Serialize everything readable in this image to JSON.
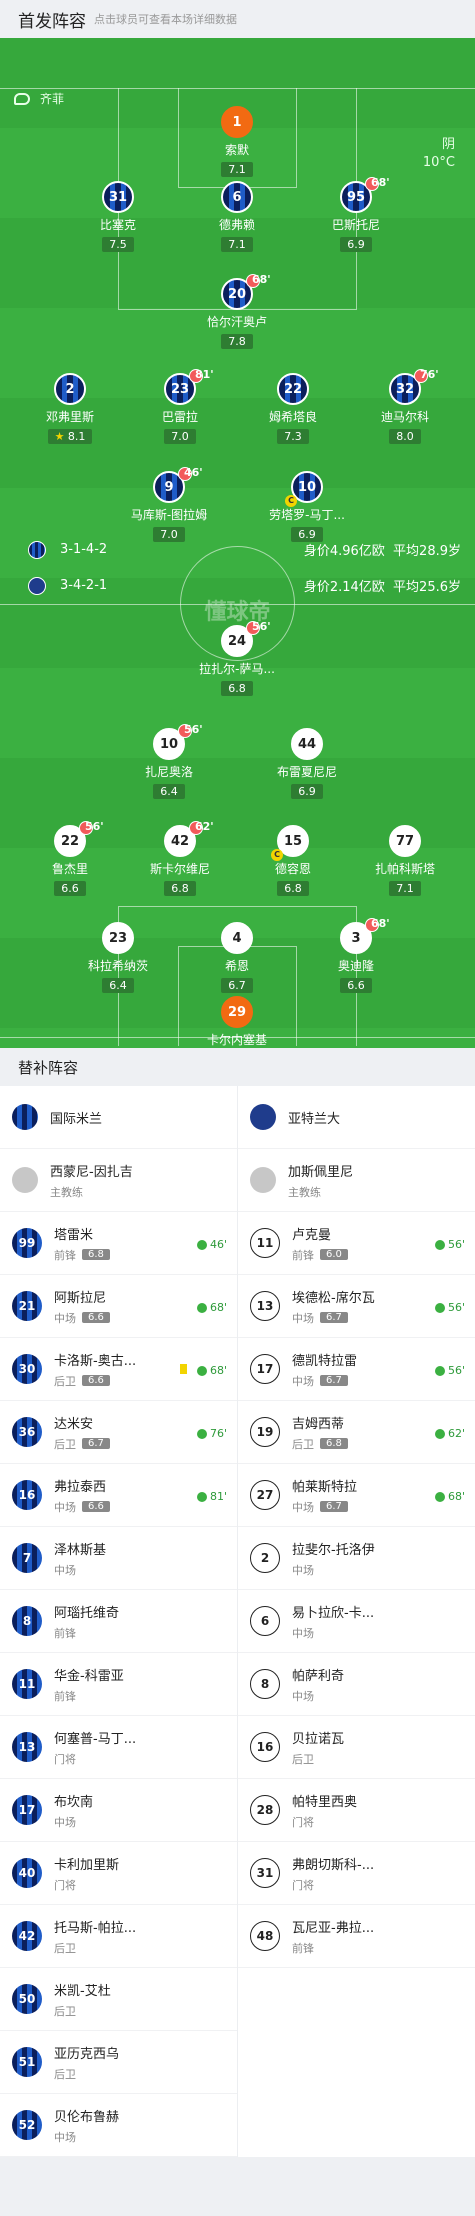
{
  "header": {
    "title": "首发阵容",
    "subtitle": "点击球员可查看本场详细数据"
  },
  "pitch": {
    "referee": "齐菲",
    "weather": {
      "cond": "阴",
      "temp": "10°C"
    },
    "home_formation": "3-1-4-2",
    "home_value": "身价4.96亿欧",
    "home_age": "平均28.9岁",
    "away_formation": "3-4-2-1",
    "away_value": "身价2.14亿欧",
    "away_age": "平均25.6岁",
    "watermark": "懂球帝"
  },
  "home_players": [
    {
      "num": "1",
      "name": "索默",
      "rating": "7.1",
      "gk": true
    },
    {
      "num": "31",
      "name": "比塞克",
      "rating": "7.5"
    },
    {
      "num": "6",
      "name": "德弗赖",
      "rating": "7.1"
    },
    {
      "num": "95",
      "name": "巴斯托尼",
      "rating": "6.9",
      "sub": "68'"
    },
    {
      "num": "20",
      "name": "恰尔汗奥卢",
      "rating": "7.8",
      "sub": "68'"
    },
    {
      "num": "2",
      "name": "邓弗里斯",
      "rating": "8.1",
      "star": true
    },
    {
      "num": "23",
      "name": "巴雷拉",
      "rating": "7.0",
      "sub": "81'"
    },
    {
      "num": "22",
      "name": "姆希塔良",
      "rating": "7.3"
    },
    {
      "num": "32",
      "name": "迪马尔科",
      "rating": "8.0",
      "sub": "76'"
    },
    {
      "num": "9",
      "name": "马库斯-图拉姆",
      "rating": "7.0",
      "sub": "46'"
    },
    {
      "num": "10",
      "name": "劳塔罗-马丁...",
      "rating": "6.9",
      "captain": true
    }
  ],
  "away_players": [
    {
      "num": "24",
      "name": "拉扎尔-萨马...",
      "rating": "6.8",
      "sub": "56'"
    },
    {
      "num": "10",
      "name": "扎尼奥洛",
      "rating": "6.4",
      "sub": "56'"
    },
    {
      "num": "44",
      "name": "布雷夏尼尼",
      "rating": "6.9"
    },
    {
      "num": "22",
      "name": "鲁杰里",
      "rating": "6.6",
      "sub": "56'"
    },
    {
      "num": "42",
      "name": "斯卡尔维尼",
      "rating": "6.8",
      "sub": "62'",
      "yellow": true
    },
    {
      "num": "15",
      "name": "德容恩",
      "rating": "6.8",
      "captain": true
    },
    {
      "num": "77",
      "name": "扎帕科斯塔",
      "rating": "7.1"
    },
    {
      "num": "23",
      "name": "科拉希纳茨",
      "rating": "6.4"
    },
    {
      "num": "4",
      "name": "希恩",
      "rating": "6.7"
    },
    {
      "num": "3",
      "name": "奥迪隆",
      "rating": "6.6",
      "sub": "68'"
    },
    {
      "num": "29",
      "name": "卡尔内塞基",
      "rating": "7.0",
      "gk": true
    }
  ],
  "subs_title": "替补阵容",
  "home_team": "国际米兰",
  "away_team": "亚特兰大",
  "home_coach": {
    "name": "西蒙尼-因扎吉",
    "role": "主教练"
  },
  "away_coach": {
    "name": "加斯佩里尼",
    "role": "主教练"
  },
  "home_subs": [
    {
      "num": "99",
      "name": "塔雷米",
      "pos": "前锋",
      "rating": "6.8",
      "in": "46'"
    },
    {
      "num": "21",
      "name": "阿斯拉尼",
      "pos": "中场",
      "rating": "6.6",
      "in": "68'"
    },
    {
      "num": "30",
      "name": "卡洛斯-奥古...",
      "pos": "后卫",
      "rating": "6.6",
      "in": "68'",
      "yellow": true
    },
    {
      "num": "36",
      "name": "达米安",
      "pos": "后卫",
      "rating": "6.7",
      "in": "76'"
    },
    {
      "num": "16",
      "name": "弗拉泰西",
      "pos": "中场",
      "rating": "6.6",
      "in": "81'"
    },
    {
      "num": "7",
      "name": "泽林斯基",
      "pos": "中场"
    },
    {
      "num": "8",
      "name": "阿瑙托维奇",
      "pos": "前锋"
    },
    {
      "num": "11",
      "name": "华金-科雷亚",
      "pos": "前锋"
    },
    {
      "num": "13",
      "name": "何塞普-马丁...",
      "pos": "门将"
    },
    {
      "num": "17",
      "name": "布坎南",
      "pos": "中场"
    },
    {
      "num": "40",
      "name": "卡利加里斯",
      "pos": "门将"
    },
    {
      "num": "42",
      "name": "托马斯-帕拉...",
      "pos": "后卫"
    },
    {
      "num": "50",
      "name": "米凯-艾杜",
      "pos": "后卫"
    },
    {
      "num": "51",
      "name": "亚历克西乌",
      "pos": "后卫"
    },
    {
      "num": "52",
      "name": "贝伦布鲁赫",
      "pos": "中场"
    }
  ],
  "away_subs": [
    {
      "num": "11",
      "name": "卢克曼",
      "pos": "前锋",
      "rating": "6.0",
      "in": "56'"
    },
    {
      "num": "13",
      "name": "埃德松-席尔瓦",
      "pos": "中场",
      "rating": "6.7",
      "in": "56'"
    },
    {
      "num": "17",
      "name": "德凯特拉雷",
      "pos": "中场",
      "rating": "6.7",
      "in": "56'"
    },
    {
      "num": "19",
      "name": "吉姆西蒂",
      "pos": "后卫",
      "rating": "6.8",
      "in": "62'"
    },
    {
      "num": "27",
      "name": "帕莱斯特拉",
      "pos": "中场",
      "rating": "6.7",
      "in": "68'"
    },
    {
      "num": "2",
      "name": "拉斐尔-托洛伊",
      "pos": "中场"
    },
    {
      "num": "6",
      "name": "易卜拉欣-卡...",
      "pos": "中场"
    },
    {
      "num": "8",
      "name": "帕萨利奇",
      "pos": "中场"
    },
    {
      "num": "16",
      "name": "贝拉诺瓦",
      "pos": "后卫"
    },
    {
      "num": "28",
      "name": "帕特里西奥",
      "pos": "门将"
    },
    {
      "num": "31",
      "name": "弗朗切斯科-...",
      "pos": "门将"
    },
    {
      "num": "48",
      "name": "瓦尼亚-弗拉...",
      "pos": "前锋"
    }
  ]
}
